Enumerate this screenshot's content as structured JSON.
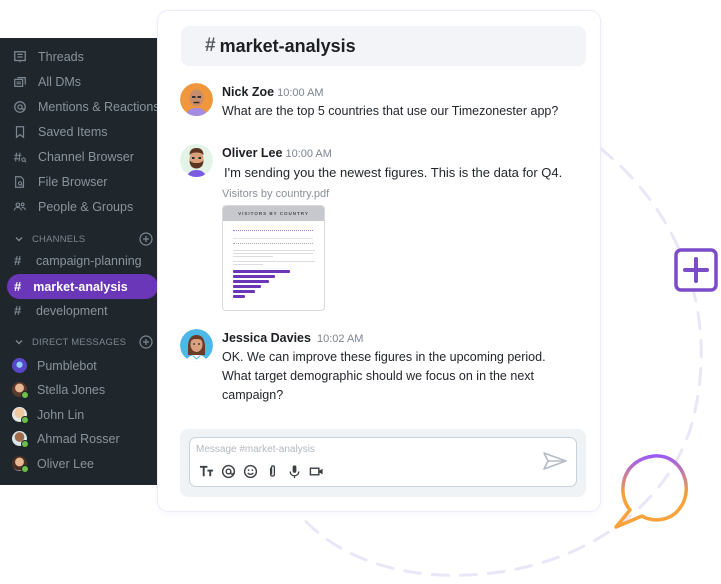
{
  "sidebar": {
    "nav_items": [
      {
        "label": "Threads",
        "icon": "threads-icon"
      },
      {
        "label": "All DMs",
        "icon": "all-dms-icon"
      },
      {
        "label": "Mentions & Reactions",
        "icon": "at-icon"
      },
      {
        "label": "Saved Items",
        "icon": "bookmark-icon"
      },
      {
        "label": "Channel Browser",
        "icon": "channel-search-icon"
      },
      {
        "label": "File Browser",
        "icon": "file-search-icon"
      },
      {
        "label": "People & Groups",
        "icon": "people-icon"
      }
    ],
    "channels_label": "CHANNELS",
    "channels": [
      {
        "label": "campaign-planning",
        "active": false
      },
      {
        "label": "market-analysis",
        "active": true
      },
      {
        "label": "development",
        "active": false
      }
    ],
    "dms_label": "DIRECT MESSAGES",
    "dms": [
      {
        "label": "Pumblebot",
        "online": false
      },
      {
        "label": "Stella Jones",
        "online": true
      },
      {
        "label": "John Lin",
        "online": true
      },
      {
        "label": "Ahmad Rosser",
        "online": true
      },
      {
        "label": "Oliver Lee",
        "online": true
      }
    ]
  },
  "channel": {
    "hash": "#",
    "name": "market-analysis"
  },
  "messages": [
    {
      "author": "Nick Zoe",
      "time": "10:00 AM",
      "text": "What are the top 5 countries that use our Timezonester app?"
    },
    {
      "author": "Oliver Lee",
      "time": "10:00 AM",
      "text": "I'm sending you the newest figures. This is the data for Q4.",
      "attachment": {
        "filename": "Visitors by country.pdf",
        "preview_title": "VISITORS BY COUNTRY"
      }
    },
    {
      "author": "Jessica Davies",
      "time": "10:02 AM",
      "text": "OK. We can improve these figures in the upcoming period. What target demographic should we focus on in the next campaign?"
    }
  ],
  "composer": {
    "placeholder": "Message #market-analysis",
    "tools": [
      "text-format-icon",
      "mention-icon",
      "emoji-icon",
      "attach-icon",
      "microphone-icon",
      "video-icon"
    ]
  },
  "colors": {
    "accent": "#6a37b8",
    "sidebar_bg": "#1f262c",
    "online": "#6cc04a",
    "chat_gradient_start": "#9b5cf6",
    "chat_gradient_end": "#f7a23b"
  }
}
